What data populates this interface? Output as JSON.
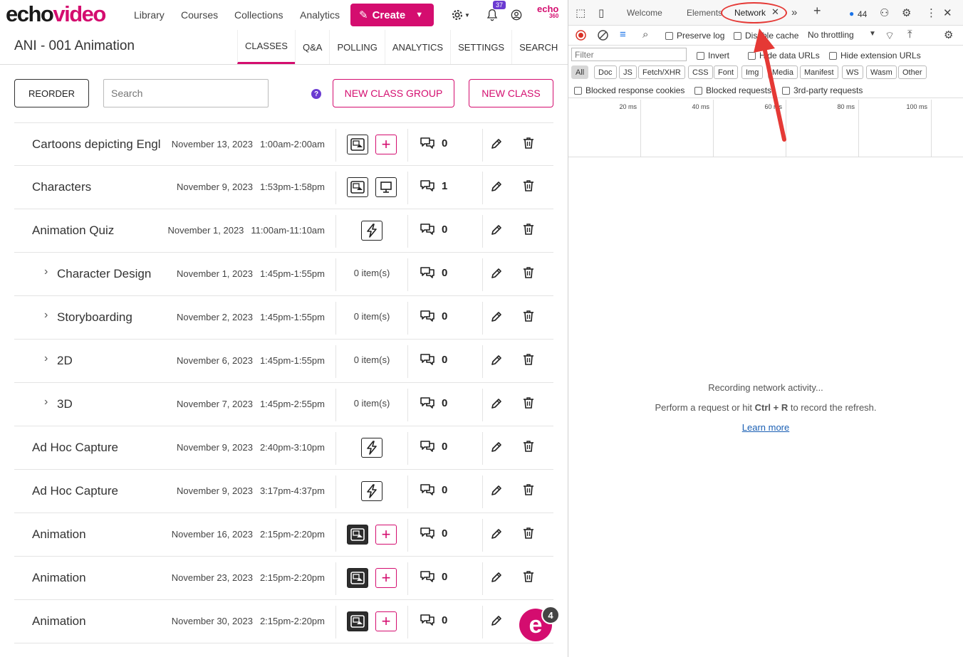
{
  "brand": {
    "part1": "echo",
    "part2": "video",
    "echo360_top": "echo",
    "echo360_bottom": "360"
  },
  "nav": {
    "links": [
      "Library",
      "Courses",
      "Collections",
      "Analytics"
    ],
    "create_label": "Create",
    "notifications_count": "37"
  },
  "course": {
    "title": "ANI - 001 Animation",
    "tabs": [
      "CLASSES",
      "Q&A",
      "POLLING",
      "ANALYTICS",
      "SETTINGS",
      "SEARCH"
    ],
    "active_tab": "CLASSES"
  },
  "toolbar": {
    "reorder_label": "REORDER",
    "search_placeholder": "Search",
    "help_label": "?",
    "new_group_label": "NEW CLASS GROUP",
    "new_class_label": "NEW CLASS"
  },
  "classes": [
    {
      "name": "Cartoons depicting Engl",
      "date": "November 13, 2023",
      "time": "1:00am-2:00am",
      "media": [
        "media",
        "add"
      ],
      "qa": "0"
    },
    {
      "name": "Characters",
      "date": "November 9, 2023",
      "time": "1:53pm-1:58pm",
      "media": [
        "media",
        "presentation"
      ],
      "qa": "1"
    },
    {
      "name": "Animation Quiz",
      "date": "November 1, 2023",
      "time": "11:00am-11:10am",
      "media": [
        "bolt"
      ],
      "qa": "0"
    },
    {
      "name": "Character Design",
      "date": "November 1, 2023",
      "time": "1:45pm-1:55pm",
      "items": "0 item(s)",
      "child": true,
      "qa": "0"
    },
    {
      "name": "Storyboarding",
      "date": "November 2, 2023",
      "time": "1:45pm-1:55pm",
      "items": "0 item(s)",
      "child": true,
      "qa": "0"
    },
    {
      "name": "2D",
      "date": "November 6, 2023",
      "time": "1:45pm-1:55pm",
      "items": "0 item(s)",
      "child": true,
      "qa": "0"
    },
    {
      "name": "3D",
      "date": "November 7, 2023",
      "time": "1:45pm-2:55pm",
      "items": "0 item(s)",
      "child": true,
      "qa": "0"
    },
    {
      "name": "Ad Hoc Capture",
      "date": "November 9, 2023",
      "time": "2:40pm-3:10pm",
      "media": [
        "bolt"
      ],
      "qa": "0"
    },
    {
      "name": "Ad Hoc Capture",
      "date": "November 9, 2023",
      "time": "3:17pm-4:37pm",
      "media": [
        "bolt"
      ],
      "qa": "0"
    },
    {
      "name": "Animation",
      "date": "November 16, 2023",
      "time": "2:15pm-2:20pm",
      "media": [
        "media-dark",
        "add"
      ],
      "qa": "0"
    },
    {
      "name": "Animation",
      "date": "November 23, 2023",
      "time": "2:15pm-2:20pm",
      "media": [
        "media-dark",
        "add"
      ],
      "qa": "0"
    },
    {
      "name": "Animation",
      "date": "November 30, 2023",
      "time": "2:15pm-2:20pm",
      "media": [
        "media-dark",
        "add"
      ],
      "qa": "0"
    }
  ],
  "fab": {
    "label": "e",
    "badge": "4"
  },
  "devtools": {
    "tabs": [
      "Welcome",
      "Elements",
      "Network"
    ],
    "active_tab": "Network",
    "issues_count": "44",
    "preserve_log": "Preserve log",
    "disable_cache": "Disable cache",
    "throttling": "No throttling",
    "filter_placeholder": "Filter",
    "invert": "Invert",
    "hide_data_urls": "Hide data URLs",
    "hide_extension_urls": "Hide extension URLs",
    "types": [
      "All",
      "Doc",
      "JS",
      "Fetch/XHR",
      "CSS",
      "Font",
      "Img",
      "Media",
      "Manifest",
      "WS",
      "Wasm",
      "Other"
    ],
    "blocked_cookies": "Blocked response cookies",
    "blocked_requests": "Blocked requests",
    "third_party": "3rd-party requests",
    "timeline_ticks": [
      "20 ms",
      "40 ms",
      "60 ms",
      "80 ms",
      "100 ms"
    ],
    "empty_line1": "Recording network activity...",
    "empty_line2_pre": "Perform a request or hit ",
    "empty_line2_key": "Ctrl + R",
    "empty_line2_post": " to record the refresh.",
    "learn_more": "Learn more"
  },
  "colors": {
    "brand_pink": "#d40d6f",
    "purple": "#6b3bd1",
    "annotation_red": "#e53935"
  }
}
